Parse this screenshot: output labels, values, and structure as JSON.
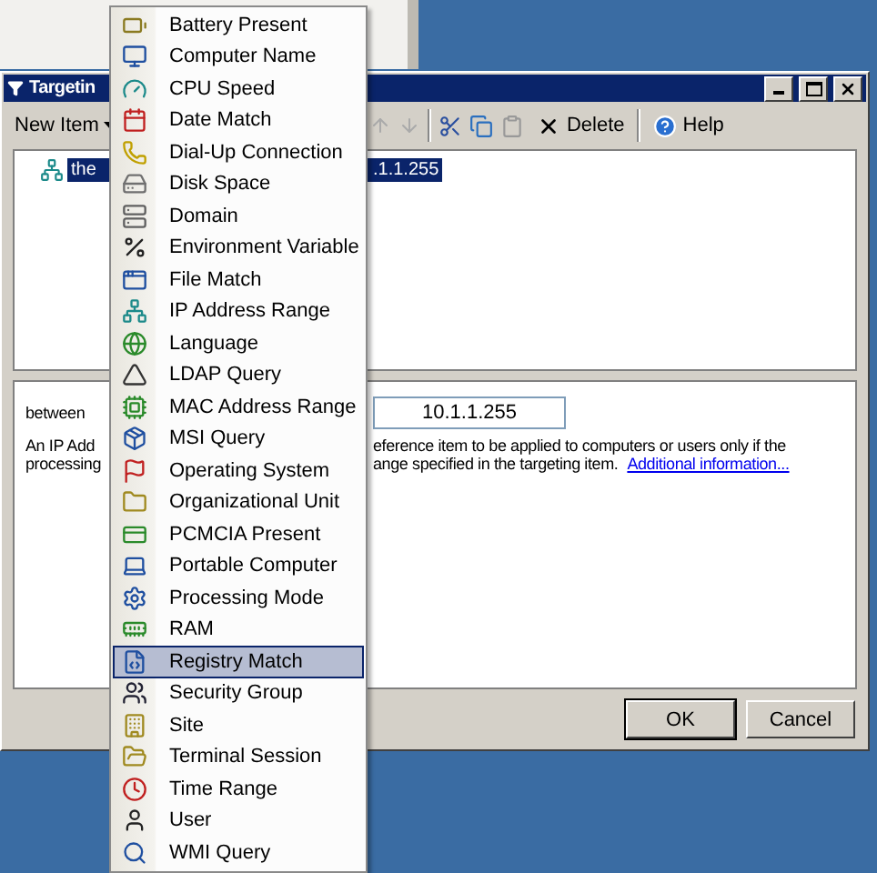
{
  "dialog": {
    "title": "Targetin"
  },
  "toolbar": {
    "new_item": "New Item",
    "delete": "Delete",
    "help": "Help"
  },
  "tree": {
    "items": [
      {
        "label_start": "the",
        "label_end": ".1.1.255",
        "selected": true
      }
    ]
  },
  "details": {
    "between_label": "between",
    "end_value": "10.1.1.255",
    "description_lines": [
      {
        "start": "An IP Add",
        "end": "eference item to be applied to computers or users only if the"
      },
      {
        "start": "processing",
        "end": "ange specified in the targeting item.",
        "link": "Additional information..."
      }
    ]
  },
  "buttons": [
    "OK",
    "Cancel"
  ],
  "menu": {
    "items": [
      {
        "label": "Battery Present",
        "selected": false
      },
      {
        "label": "Computer Name",
        "selected": false
      },
      {
        "label": "CPU Speed",
        "selected": false
      },
      {
        "label": "Date Match",
        "selected": false
      },
      {
        "label": "Dial-Up Connection",
        "selected": false
      },
      {
        "label": "Disk Space",
        "selected": false
      },
      {
        "label": "Domain",
        "selected": false
      },
      {
        "label": "Environment Variable",
        "selected": false
      },
      {
        "label": "File Match",
        "selected": false
      },
      {
        "label": "IP Address Range",
        "selected": false
      },
      {
        "label": "Language",
        "selected": false
      },
      {
        "label": "LDAP Query",
        "selected": false
      },
      {
        "label": "MAC Address Range",
        "selected": false
      },
      {
        "label": "MSI Query",
        "selected": false
      },
      {
        "label": "Operating System",
        "selected": false
      },
      {
        "label": "Organizational Unit",
        "selected": false
      },
      {
        "label": "PCMCIA Present",
        "selected": false
      },
      {
        "label": "Portable Computer",
        "selected": false
      },
      {
        "label": "Processing Mode",
        "selected": false
      },
      {
        "label": "RAM",
        "selected": false
      },
      {
        "label": "Registry Match",
        "selected": true
      },
      {
        "label": "Security Group",
        "selected": false
      },
      {
        "label": "Site",
        "selected": false
      },
      {
        "label": "Terminal Session",
        "selected": false
      },
      {
        "label": "Time Range",
        "selected": false
      },
      {
        "label": "User",
        "selected": false
      },
      {
        "label": "WMI Query",
        "selected": false
      }
    ]
  }
}
